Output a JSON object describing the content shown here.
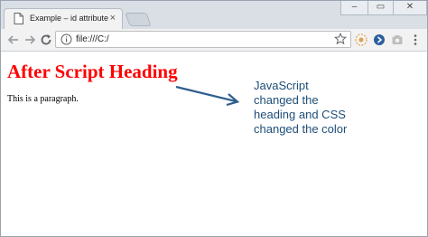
{
  "browser": {
    "tab_title": "Example – id attribute",
    "tab_close_glyph": "×",
    "url": "file:///C:/",
    "window_controls": {
      "minimize": "‒",
      "maximize": "▭",
      "close": "✕"
    },
    "icons": [
      "page-icon",
      "back-arrow-icon",
      "forward-arrow-icon",
      "reload-icon",
      "info-icon",
      "star-icon",
      "extension-icon",
      "extension-icon",
      "extension-icon"
    ]
  },
  "page": {
    "heading": "After Script Heading",
    "heading_color": "#ff0000",
    "paragraph": "This is a paragraph."
  },
  "annotation": {
    "lines": [
      "JavaScript",
      "changed the",
      "heading and CSS",
      "changed the color"
    ],
    "color": "#1f4e79"
  }
}
